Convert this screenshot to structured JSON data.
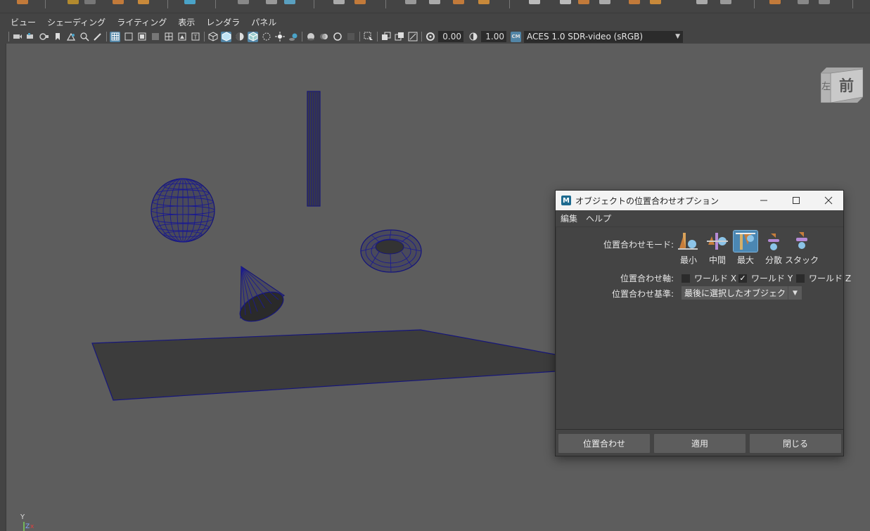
{
  "top_shelf": {
    "icons": [
      "shelf-icon",
      "shelf-icon",
      "shelf-icon",
      "shelf-icon",
      "shelf-icon",
      "shelf-icon",
      "shelf-icon",
      "shelf-icon",
      "shelf-icon",
      "shelf-icon",
      "shelf-icon",
      "shelf-icon",
      "shelf-icon",
      "shelf-icon",
      "shelf-icon",
      "shelf-icon",
      "shelf-icon",
      "shelf-icon",
      "shelf-icon",
      "shelf-icon",
      "shelf-icon",
      "shelf-icon",
      "shelf-icon",
      "shelf-icon",
      "shelf-icon"
    ]
  },
  "panel_menu": {
    "items": [
      "ビュー",
      "シェーディング",
      "ライティング",
      "表示",
      "レンダラ",
      "パネル"
    ]
  },
  "toolbar": {
    "exposure_value": "0.00",
    "gamma_value": "1.00",
    "colorspace_label": "ACES 1.0 SDR-video (sRGB)",
    "cm_badge": "CM"
  },
  "viewcube": {
    "front_label": "前",
    "left_label": "左"
  },
  "dialog": {
    "title": "オブジェクトの位置合わせオプション",
    "app_icon": "M",
    "menu": [
      "編集",
      "ヘルプ"
    ],
    "mode_label": "位置合わせモード:",
    "modes": [
      {
        "label": "最小",
        "icon": "align-min-icon",
        "selected": false
      },
      {
        "label": "中間",
        "icon": "align-mid-icon",
        "selected": false
      },
      {
        "label": "最大",
        "icon": "align-max-icon",
        "selected": true
      },
      {
        "label": "分散",
        "icon": "align-distribute-icon",
        "selected": false
      },
      {
        "label": "スタック",
        "icon": "align-stack-icon",
        "selected": false
      }
    ],
    "axis_label": "位置合わせ軸:",
    "axes": [
      {
        "label": "ワールド X",
        "checked": false
      },
      {
        "label": "ワールド Y",
        "checked": true
      },
      {
        "label": "ワールド Z",
        "checked": false
      }
    ],
    "align_to_label": "位置合わせ基準:",
    "align_to_value": "最後に選択したオブジェクト",
    "buttons": {
      "align": "位置合わせ",
      "apply": "適用",
      "close": "閉じる"
    }
  },
  "axis_indicator": {
    "y": "Y",
    "z": "Z"
  },
  "colors": {
    "viewport_bg": "#5d5d5d",
    "wireframe": "#16167a",
    "selection_highlight": "#5285a6"
  }
}
